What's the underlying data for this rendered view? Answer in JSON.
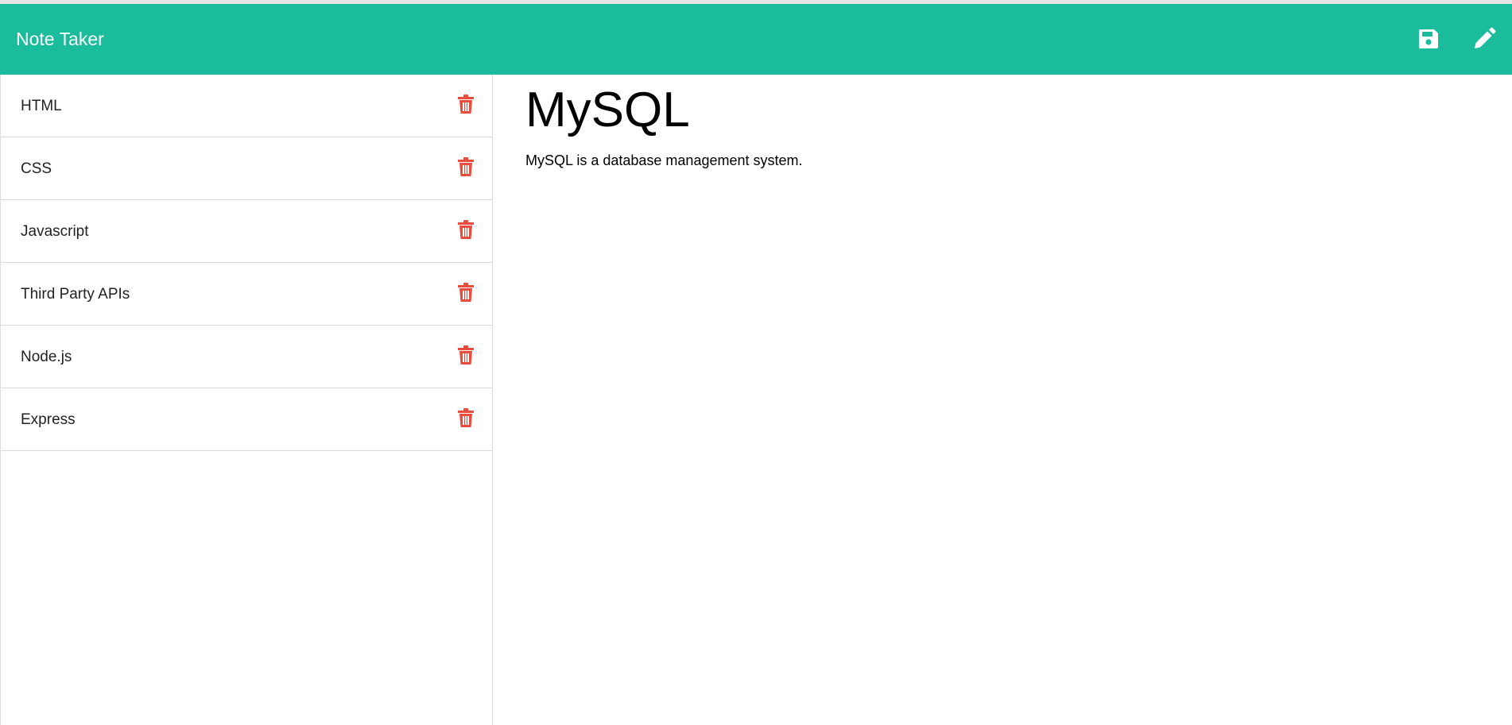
{
  "navbar": {
    "brand": "Note Taker",
    "save_icon": "floppy-disk-icon",
    "edit_icon": "pencil-icon",
    "bg_color": "#1abc9c"
  },
  "sidebar": {
    "delete_icon": "trash-icon",
    "delete_color": "#e74c3c",
    "notes": [
      {
        "title": "HTML"
      },
      {
        "title": "CSS"
      },
      {
        "title": "Javascript"
      },
      {
        "title": "Third Party APIs"
      },
      {
        "title": "Node.js"
      },
      {
        "title": "Express"
      }
    ]
  },
  "main": {
    "note_title": "MySQL",
    "note_text": "MySQL is a database management system."
  }
}
